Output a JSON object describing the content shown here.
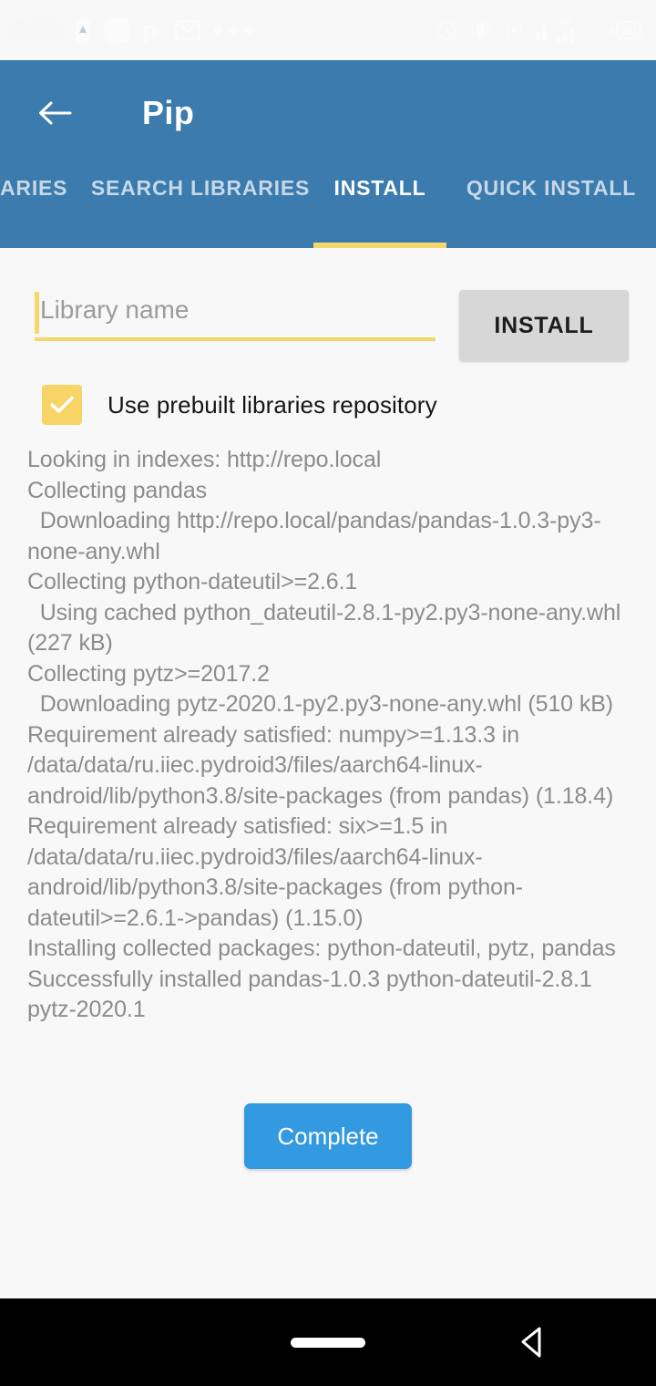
{
  "statusbar": {
    "time": "8:09",
    "left_icons": [
      "battery-alert-icon",
      "square-app-icon",
      "p-app-icon",
      "gmail-icon",
      "more-dots-icon"
    ],
    "network_speed": "1.5",
    "network_speed_unit": "K/s",
    "mobile_net": "4G",
    "battery_level": "90",
    "right_icons": [
      "alarm-icon",
      "vibrate-icon",
      "hotspot-icon",
      "signal-icon",
      "signal-4g-icon",
      "battery-icon"
    ]
  },
  "appbar": {
    "back_icon": "arrow-left-icon",
    "title": "Pip"
  },
  "tabs": [
    {
      "label": "ARIES",
      "active": false
    },
    {
      "label": "SEARCH LIBRARIES",
      "active": false
    },
    {
      "label": "INSTALL",
      "active": true
    },
    {
      "label": "QUICK INSTALL",
      "active": false
    }
  ],
  "form": {
    "library_input_value": "",
    "library_input_placeholder": "Library name",
    "install_button_label": "INSTALL",
    "checkbox_checked": true,
    "checkbox_label": "Use prebuilt libraries repository"
  },
  "log": {
    "text": "Looking in indexes: http://repo.local\nCollecting pandas\n  Downloading http://repo.local/pandas/pandas-1.0.3-py3-none-any.whl\nCollecting python-dateutil>=2.6.1\n  Using cached python_dateutil-2.8.1-py2.py3-none-any.whl (227 kB)\nCollecting pytz>=2017.2\n  Downloading pytz-2020.1-py2.py3-none-any.whl (510 kB)\nRequirement already satisfied: numpy>=1.13.3 in /data/data/ru.iiec.pydroid3/files/aarch64-linux-android/lib/python3.8/site-packages (from pandas) (1.18.4)\nRequirement already satisfied: six>=1.5 in /data/data/ru.iiec.pydroid3/files/aarch64-linux-android/lib/python3.8/site-packages (from python-dateutil>=2.6.1->pandas) (1.15.0)\nInstalling collected packages: python-dateutil, pytz, pandas\nSuccessfully installed pandas-1.0.3 python-dateutil-2.8.1 pytz-2020.1"
  },
  "footer": {
    "complete_button_label": "Complete"
  },
  "navbar": {
    "home_icon": "home-pill-icon",
    "back_icon": "nav-back-triangle-icon"
  },
  "colors": {
    "appbar": "#3b7bad",
    "accent_yellow": "#f5d76e",
    "complete_blue": "#3399e0",
    "background": "#f8f8f8",
    "install_button": "#d7d7d7"
  }
}
